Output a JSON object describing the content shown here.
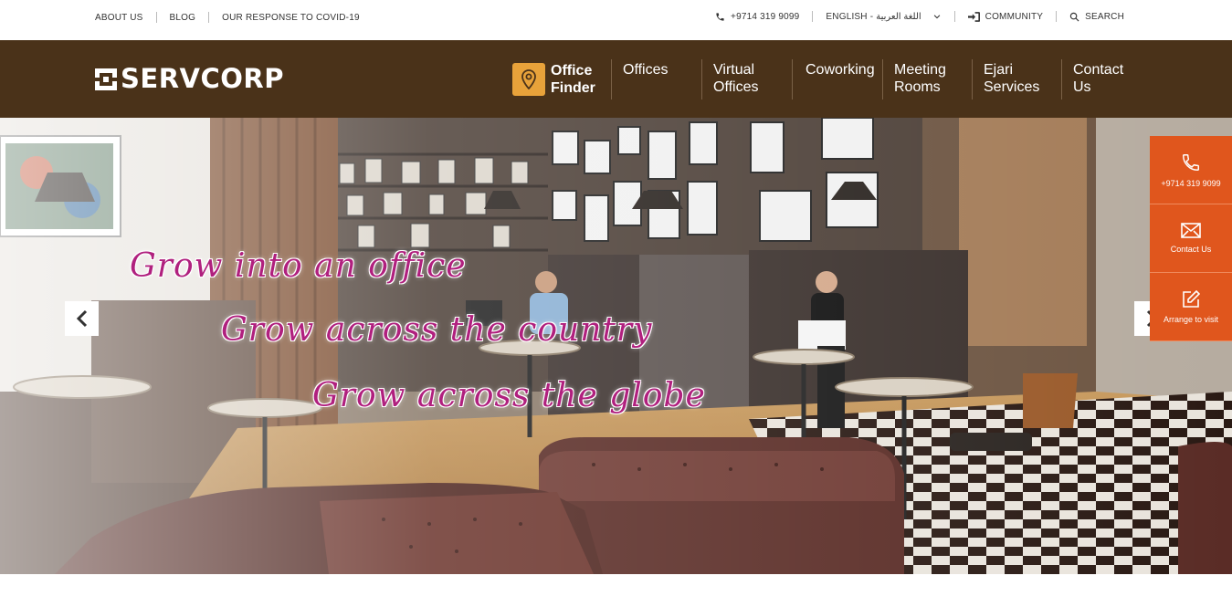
{
  "topbar": {
    "about": "ABOUT US",
    "blog": "BLOG",
    "covid": "OUR RESPONSE TO COVID-19",
    "phone": "+9714 319 9099",
    "language": "ENGLISH - اللغة العربية",
    "community": "COMMUNITY",
    "search": "SEARCH"
  },
  "brand": {
    "name": "SERVCORP"
  },
  "nav": {
    "finder": "Office Finder",
    "items": [
      "Offices",
      "Virtual Offices",
      "Coworking",
      "Meeting Rooms",
      "Ejari Services",
      "Contact Us"
    ]
  },
  "hero": {
    "lines": [
      "Grow into an office",
      "Grow across the country",
      "Grow across the globe"
    ]
  },
  "side": {
    "phone": "+9714 319 9099",
    "contact": "Contact Us",
    "visit": "Arrange to visit"
  },
  "colors": {
    "nav_bg": "#4a3219",
    "accent": "#e8a23a",
    "side_bg": "#e0561d",
    "headline": "#b0207e"
  },
  "icons": [
    "phone-icon",
    "chevron-down-icon",
    "sign-in-icon",
    "search-icon",
    "map-pin-icon",
    "envelope-icon",
    "edit-icon",
    "chevron-left-icon",
    "chevron-right-icon"
  ]
}
